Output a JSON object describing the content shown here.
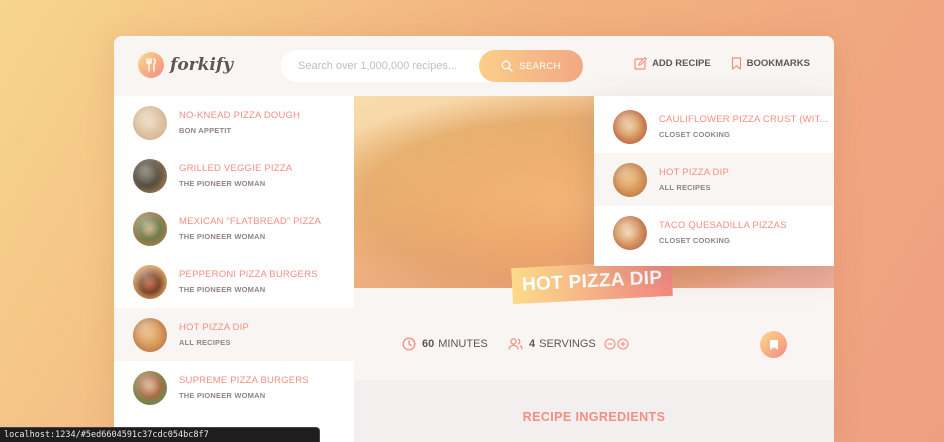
{
  "colors": {
    "accent": "#f38e82",
    "gradient_start": "#fbdb89",
    "gradient_end": "#f48982",
    "text_dark": "#615551",
    "text_muted": "#918581"
  },
  "header": {
    "logo_text": "forkify",
    "search_placeholder": "Search over 1,000,000 recipes...",
    "search_button": "SEARCH",
    "nav": {
      "add_recipe": "ADD RECIPE",
      "bookmarks": "BOOKMARKS"
    }
  },
  "results": [
    {
      "title": "NO-KNEAD PIZZA DOUGH",
      "publisher": "BON APPETIT",
      "thumb": "t-dough"
    },
    {
      "title": "GRILLED VEGGIE PIZZA",
      "publisher": "THE PIONEER WOMAN",
      "thumb": "t-veggie"
    },
    {
      "title": "MEXICAN “FLATBREAD” PIZZA",
      "publisher": "THE PIONEER WOMAN",
      "thumb": "t-mexican"
    },
    {
      "title": "PEPPERONI PIZZA BURGERS",
      "publisher": "THE PIONEER WOMAN",
      "thumb": "t-pepperoni"
    },
    {
      "title": "HOT PIZZA DIP",
      "publisher": "ALL RECIPES",
      "thumb": "t-hotdip",
      "active": true
    },
    {
      "title": "SUPREME PIZZA BURGERS",
      "publisher": "THE PIONEER WOMAN",
      "thumb": "t-supreme"
    }
  ],
  "bookmarks": [
    {
      "title": "CAULIFLOWER PIZZA CRUST (WIT...",
      "publisher": "CLOSET COOKING",
      "thumb": "t-cauli"
    },
    {
      "title": "HOT PIZZA DIP",
      "publisher": "ALL RECIPES",
      "thumb": "t-hotdip"
    },
    {
      "title": "TACO QUESADILLA PIZZAS",
      "publisher": "CLOSET COOKING",
      "thumb": "t-taco"
    }
  ],
  "recipe": {
    "title": "HOT PIZZA DIP",
    "minutes": "60",
    "minutes_label": "MINUTES",
    "servings": "4",
    "servings_label": "SERVINGS",
    "ingredients_title": "RECIPE INGREDIENTS"
  },
  "statusbar": {
    "url": "localhost:1234/#5ed6604591c37cdc054bc8f7"
  }
}
